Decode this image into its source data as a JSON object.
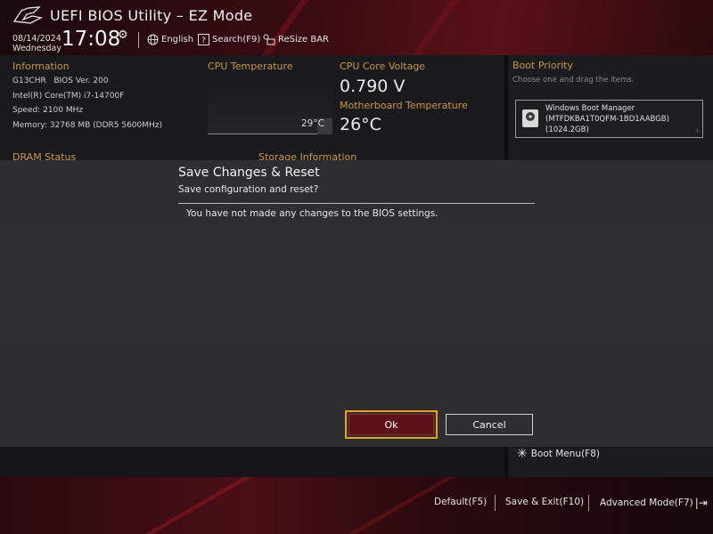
{
  "header": {
    "title": "UEFI BIOS Utility – EZ Mode",
    "date": "08/14/2024",
    "weekday": "Wednesday",
    "time": "17:08",
    "language": "English",
    "search": "Search(F9)",
    "resize_bar": "ReSize BAR"
  },
  "information": {
    "label": "Information",
    "model": "G13CHR",
    "bios": "BIOS Ver. 200",
    "cpu": "Intel(R) Core(TM) i7-14700F",
    "speed": "Speed: 2100 MHz",
    "memory": "Memory: 32768 MB (DDR5 5600MHz)"
  },
  "cpu_temperature": {
    "label": "CPU Temperature",
    "value": "29°C"
  },
  "cpu_core_voltage": {
    "label": "CPU Core Voltage",
    "value": "0.790 V"
  },
  "motherboard_temperature": {
    "label": "Motherboard Temperature",
    "value": "26°C"
  },
  "dram_status": {
    "label": "DRAM Status"
  },
  "storage_information": {
    "label": "Storage Information"
  },
  "boot_priority": {
    "label": "Boot Priority",
    "hint": "Choose one and drag the items.",
    "items": [
      {
        "line1": "Windows Boot Manager",
        "line2": "(MTFDKBA1T0QFM-1BD1AABGB)",
        "line3": "(1024.2GB)"
      }
    ]
  },
  "boot_menu": "Boot Menu(F8)",
  "dialog": {
    "title": "Save Changes & Reset",
    "subtitle": "Save configuration and reset?",
    "message": "You have not made any changes to the BIOS settings.",
    "ok": "Ok",
    "cancel": "Cancel"
  },
  "footer": {
    "default": "Default(F5)",
    "save_exit": "Save & Exit(F10)",
    "advanced": "Advanced Mode(F7)"
  },
  "colors": {
    "accent_gold": "#c59a3a",
    "focus_frame": "#e7a21f",
    "ok_button": "#5c1218"
  },
  "icons": [
    "rog-logo-icon",
    "gear-icon",
    "globe-icon",
    "search-icon",
    "resize-bar-icon",
    "disk-icon",
    "drag-handle-icon",
    "boot-menu-icon",
    "exit-icon"
  ]
}
